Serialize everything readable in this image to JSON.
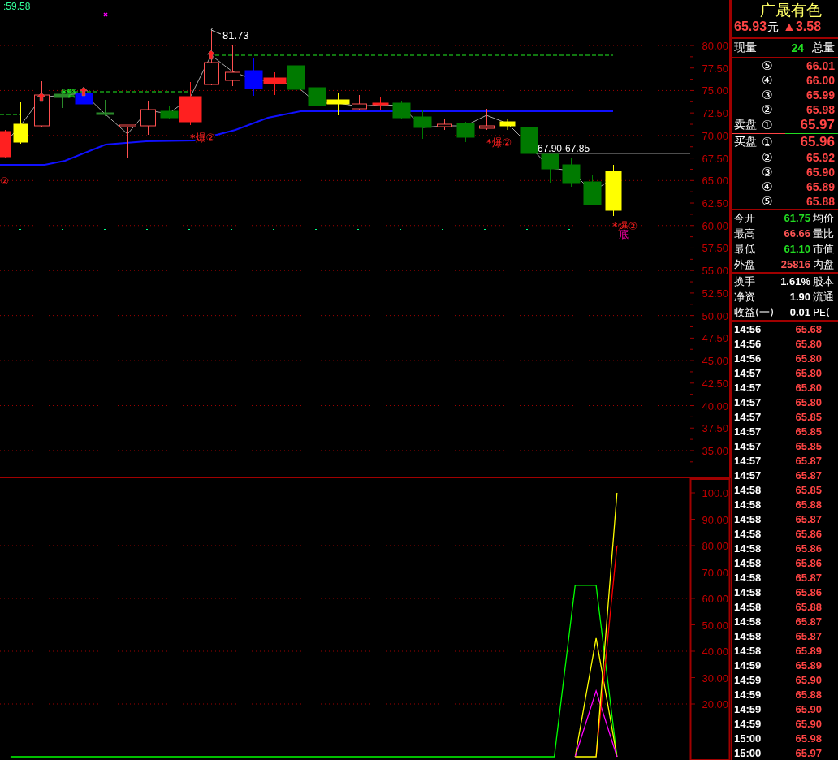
{
  "price_chart": {
    "header": ":59.58",
    "high_label": "81.73",
    "range_label": "67.90-67.85",
    "warning": "*警",
    "edge_mark": "②",
    "signals": [
      {
        "text": "*爆②"
      },
      {
        "text": "*爆②"
      },
      {
        "text": "*爆②"
      },
      {
        "text": "底"
      }
    ],
    "axis_labels": [
      "80.00",
      "77.50",
      "75.00",
      "72.50",
      "70.00",
      "67.50",
      "65.00",
      "62.50",
      "60.00",
      "57.50",
      "55.00",
      "52.50",
      "50.00",
      "47.50",
      "45.00",
      "42.50",
      "40.00",
      "37.50",
      "35.00"
    ]
  },
  "indicator_chart": {
    "chart_data": {
      "type": "line",
      "categories": [
        null,
        null,
        null,
        null,
        null,
        null,
        null,
        null,
        null,
        null,
        null,
        null,
        null,
        null,
        null,
        null,
        null,
        null,
        null,
        null,
        null,
        null,
        null,
        null,
        null,
        null,
        null,
        null,
        null,
        null,
        null,
        null,
        null
      ],
      "ylim": [
        0,
        100
      ],
      "grid": true,
      "yticks": [
        {
          "value": 20,
          "label": "20.00"
        },
        {
          "value": 30,
          "label": "30.00"
        },
        {
          "value": 40,
          "label": "40.00"
        },
        {
          "value": 50,
          "label": "50.00"
        },
        {
          "value": 60,
          "label": "60.00"
        },
        {
          "value": 70,
          "label": "70.00"
        },
        {
          "value": 80,
          "label": "80.00"
        },
        {
          "value": 90,
          "label": "90.00"
        },
        {
          "value": 100,
          "label": "100.0"
        }
      ],
      "series": [
        {
          "color": "#00ff00",
          "values": [
            0,
            0,
            0,
            0,
            0,
            0,
            0,
            0,
            0,
            0,
            0,
            0,
            0,
            0,
            0,
            0,
            0,
            0,
            0,
            0,
            0,
            0,
            0,
            0,
            0,
            0,
            0,
            65,
            65,
            0,
            null,
            null,
            null
          ]
        },
        {
          "color": "#ffff00",
          "values": [
            null,
            null,
            null,
            null,
            null,
            null,
            null,
            null,
            null,
            null,
            null,
            null,
            null,
            null,
            null,
            null,
            null,
            null,
            null,
            null,
            null,
            null,
            null,
            null,
            null,
            null,
            null,
            0,
            45,
            0,
            null,
            null,
            null
          ]
        },
        {
          "color": "#ff00ff",
          "values": [
            null,
            null,
            null,
            null,
            null,
            null,
            null,
            null,
            null,
            null,
            null,
            null,
            null,
            null,
            null,
            null,
            null,
            null,
            null,
            null,
            null,
            null,
            null,
            null,
            null,
            null,
            null,
            0,
            25,
            0,
            null,
            null,
            null
          ]
        },
        {
          "color": "#ff0000",
          "values": [
            null,
            null,
            null,
            null,
            null,
            null,
            null,
            null,
            null,
            null,
            null,
            null,
            null,
            null,
            null,
            null,
            null,
            null,
            null,
            null,
            null,
            null,
            null,
            null,
            null,
            null,
            null,
            null,
            0,
            80,
            null,
            null,
            null
          ]
        },
        {
          "color": "#ffff00",
          "values": [
            null,
            null,
            null,
            null,
            null,
            null,
            null,
            null,
            null,
            null,
            null,
            null,
            null,
            null,
            null,
            null,
            null,
            null,
            null,
            null,
            null,
            null,
            null,
            null,
            null,
            null,
            null,
            0,
            0,
            100,
            null,
            null,
            null
          ]
        }
      ]
    }
  },
  "quote": {
    "name": "广晟有色",
    "price": "65.93",
    "unit": "元",
    "change": "▲3.58",
    "volume": {
      "label": "现量",
      "value": "24",
      "trailing": "总量"
    },
    "asks": [
      {
        "marker": "⑤",
        "price": "66.01"
      },
      {
        "marker": "④",
        "price": "66.00"
      },
      {
        "marker": "③",
        "price": "65.99"
      },
      {
        "marker": "②",
        "price": "65.98"
      },
      {
        "label": "卖盘",
        "marker": "①",
        "price": "65.97",
        "kind": "best"
      }
    ],
    "bids": [
      {
        "label": "买盘",
        "marker": "①",
        "price": "65.96",
        "kind": "best"
      },
      {
        "marker": "②",
        "price": "65.92"
      },
      {
        "marker": "③",
        "price": "65.90"
      },
      {
        "marker": "④",
        "price": "65.89"
      },
      {
        "marker": "⑤",
        "price": "65.88"
      }
    ],
    "stats": [
      {
        "label": "今开",
        "value": "61.75",
        "color": "#22dd22",
        "trailing": "均价"
      },
      {
        "label": "最高",
        "value": "66.66",
        "color": "#ff5555",
        "trailing": "量比"
      },
      {
        "label": "最低",
        "value": "61.10",
        "color": "#22dd22",
        "trailing": "市值"
      },
      {
        "label": "外盘",
        "value": "25816",
        "color": "#ff5555",
        "trailing": "内盘"
      }
    ],
    "fundamentals": [
      {
        "label": "换手",
        "value": "1.61%",
        "trailing": "股本"
      },
      {
        "label": "净资",
        "value": "1.90",
        "trailing": "流通"
      },
      {
        "label": "收益(一)",
        "value": "0.01",
        "trailing": "PE("
      }
    ],
    "trades": [
      {
        "time": "14:56",
        "price": "65.68"
      },
      {
        "time": "14:56",
        "price": "65.80"
      },
      {
        "time": "14:56",
        "price": "65.80"
      },
      {
        "time": "14:57",
        "price": "65.80"
      },
      {
        "time": "14:57",
        "price": "65.80"
      },
      {
        "time": "14:57",
        "price": "65.80"
      },
      {
        "time": "14:57",
        "price": "65.85"
      },
      {
        "time": "14:57",
        "price": "65.85"
      },
      {
        "time": "14:57",
        "price": "65.85"
      },
      {
        "time": "14:57",
        "price": "65.87"
      },
      {
        "time": "14:57",
        "price": "65.87"
      },
      {
        "time": "14:58",
        "price": "65.85"
      },
      {
        "time": "14:58",
        "price": "65.88"
      },
      {
        "time": "14:58",
        "price": "65.87"
      },
      {
        "time": "14:58",
        "price": "65.86"
      },
      {
        "time": "14:58",
        "price": "65.86"
      },
      {
        "time": "14:58",
        "price": "65.86"
      },
      {
        "time": "14:58",
        "price": "65.87"
      },
      {
        "time": "14:58",
        "price": "65.86"
      },
      {
        "time": "14:58",
        "price": "65.88"
      },
      {
        "time": "14:58",
        "price": "65.87"
      },
      {
        "time": "14:58",
        "price": "65.87"
      },
      {
        "time": "14:58",
        "price": "65.89"
      },
      {
        "time": "14:59",
        "price": "65.89"
      },
      {
        "time": "14:59",
        "price": "65.90"
      },
      {
        "time": "14:59",
        "price": "65.88"
      },
      {
        "time": "14:59",
        "price": "65.90"
      },
      {
        "time": "14:59",
        "price": "65.90"
      },
      {
        "time": "15:00",
        "price": "65.98"
      },
      {
        "time": "15:00",
        "price": "65.97"
      }
    ]
  }
}
